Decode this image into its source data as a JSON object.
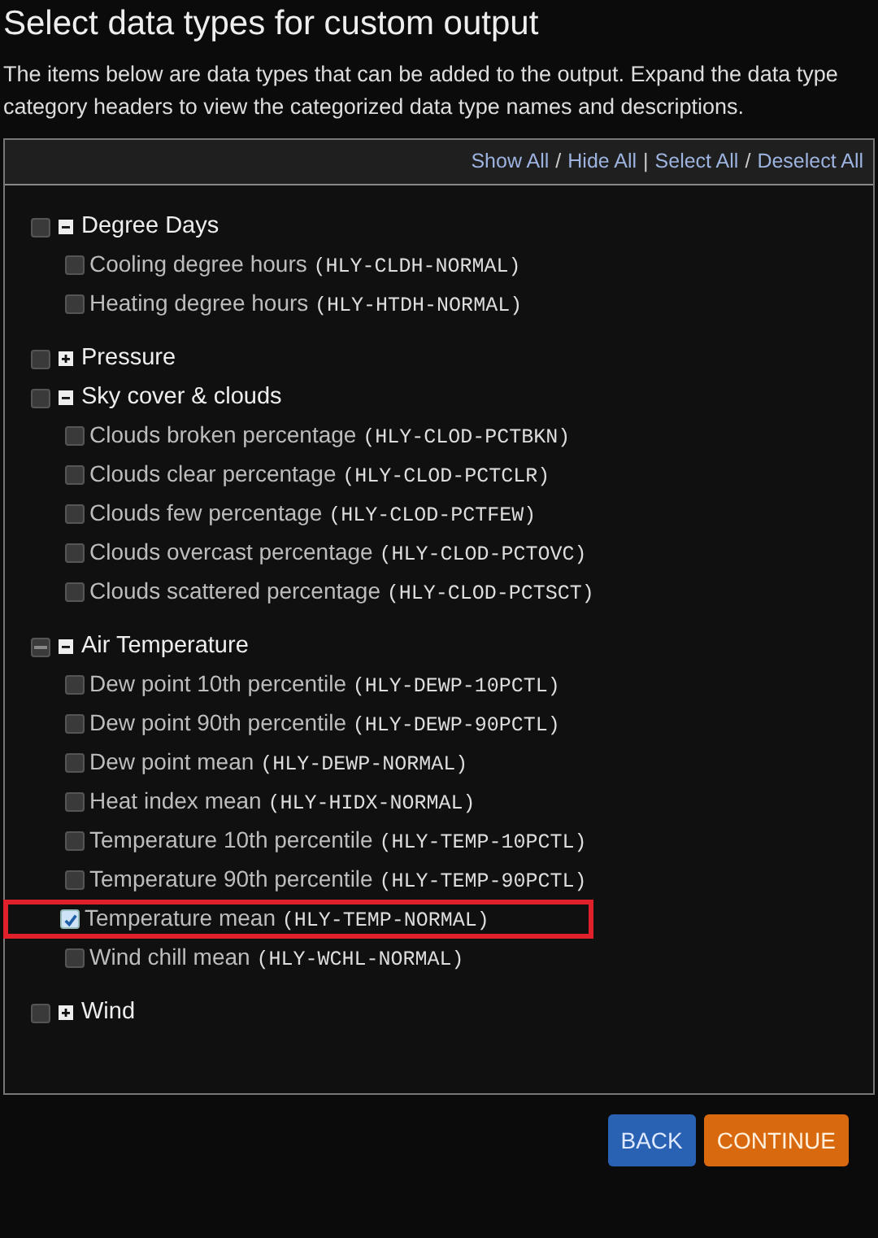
{
  "title": "Select data types for custom output",
  "description": "The items below are data types that can be added to the output. Expand the data type category headers to view the categorized data type names and descriptions.",
  "toolbar": [
    {
      "kind": "link",
      "text": "Show All"
    },
    {
      "kind": "sep",
      "text": "/"
    },
    {
      "kind": "link",
      "text": "Hide All"
    },
    {
      "kind": "sep",
      "text": "|"
    },
    {
      "kind": "link",
      "text": "Select All"
    },
    {
      "kind": "sep",
      "text": "/"
    },
    {
      "kind": "link",
      "text": "Deselect All"
    }
  ],
  "categories": [
    {
      "label": "Degree Days",
      "expanded": true,
      "partial": false,
      "children": [
        {
          "name": "Cooling degree hours",
          "code": "(HLY-CLDH-NORMAL)",
          "checked": false,
          "highlighted": false
        },
        {
          "name": "Heating degree hours",
          "code": "(HLY-HTDH-NORMAL)",
          "checked": false,
          "highlighted": false
        }
      ]
    },
    {
      "label": "Pressure",
      "expanded": false,
      "partial": false
    },
    {
      "label": "Sky cover & clouds",
      "expanded": true,
      "partial": false,
      "children": [
        {
          "name": "Clouds broken percentage",
          "code": "(HLY-CLOD-PCTBKN)",
          "checked": false,
          "highlighted": false
        },
        {
          "name": "Clouds clear percentage",
          "code": "(HLY-CLOD-PCTCLR)",
          "checked": false,
          "highlighted": false
        },
        {
          "name": "Clouds few percentage",
          "code": "(HLY-CLOD-PCTFEW)",
          "checked": false,
          "highlighted": false
        },
        {
          "name": "Clouds overcast percentage",
          "code": "(HLY-CLOD-PCTOVC)",
          "checked": false,
          "highlighted": false
        },
        {
          "name": "Clouds scattered percentage",
          "code": "(HLY-CLOD-PCTSCT)",
          "checked": false,
          "highlighted": false
        }
      ]
    },
    {
      "label": "Air Temperature",
      "expanded": true,
      "partial": true,
      "children": [
        {
          "name": "Dew point 10th percentile",
          "code": "(HLY-DEWP-10PCTL)",
          "checked": false,
          "highlighted": false
        },
        {
          "name": "Dew point 90th percentile",
          "code": "(HLY-DEWP-90PCTL)",
          "checked": false,
          "highlighted": false
        },
        {
          "name": "Dew point mean",
          "code": "(HLY-DEWP-NORMAL)",
          "checked": false,
          "highlighted": false
        },
        {
          "name": "Heat index mean",
          "code": "(HLY-HIDX-NORMAL)",
          "checked": false,
          "highlighted": false
        },
        {
          "name": "Temperature 10th percentile",
          "code": "(HLY-TEMP-10PCTL)",
          "checked": false,
          "highlighted": false
        },
        {
          "name": "Temperature 90th percentile",
          "code": "(HLY-TEMP-90PCTL)",
          "checked": false,
          "highlighted": false
        },
        {
          "name": "Temperature mean",
          "code": "(HLY-TEMP-NORMAL)",
          "checked": true,
          "highlighted": true
        },
        {
          "name": "Wind chill mean",
          "code": "(HLY-WCHL-NORMAL)",
          "checked": false,
          "highlighted": false
        }
      ]
    },
    {
      "label": "Wind",
      "expanded": false,
      "partial": false
    }
  ],
  "buttons": [
    {
      "kind": "back",
      "label": "BACK"
    },
    {
      "kind": "continue",
      "label": "CONTINUE"
    }
  ]
}
